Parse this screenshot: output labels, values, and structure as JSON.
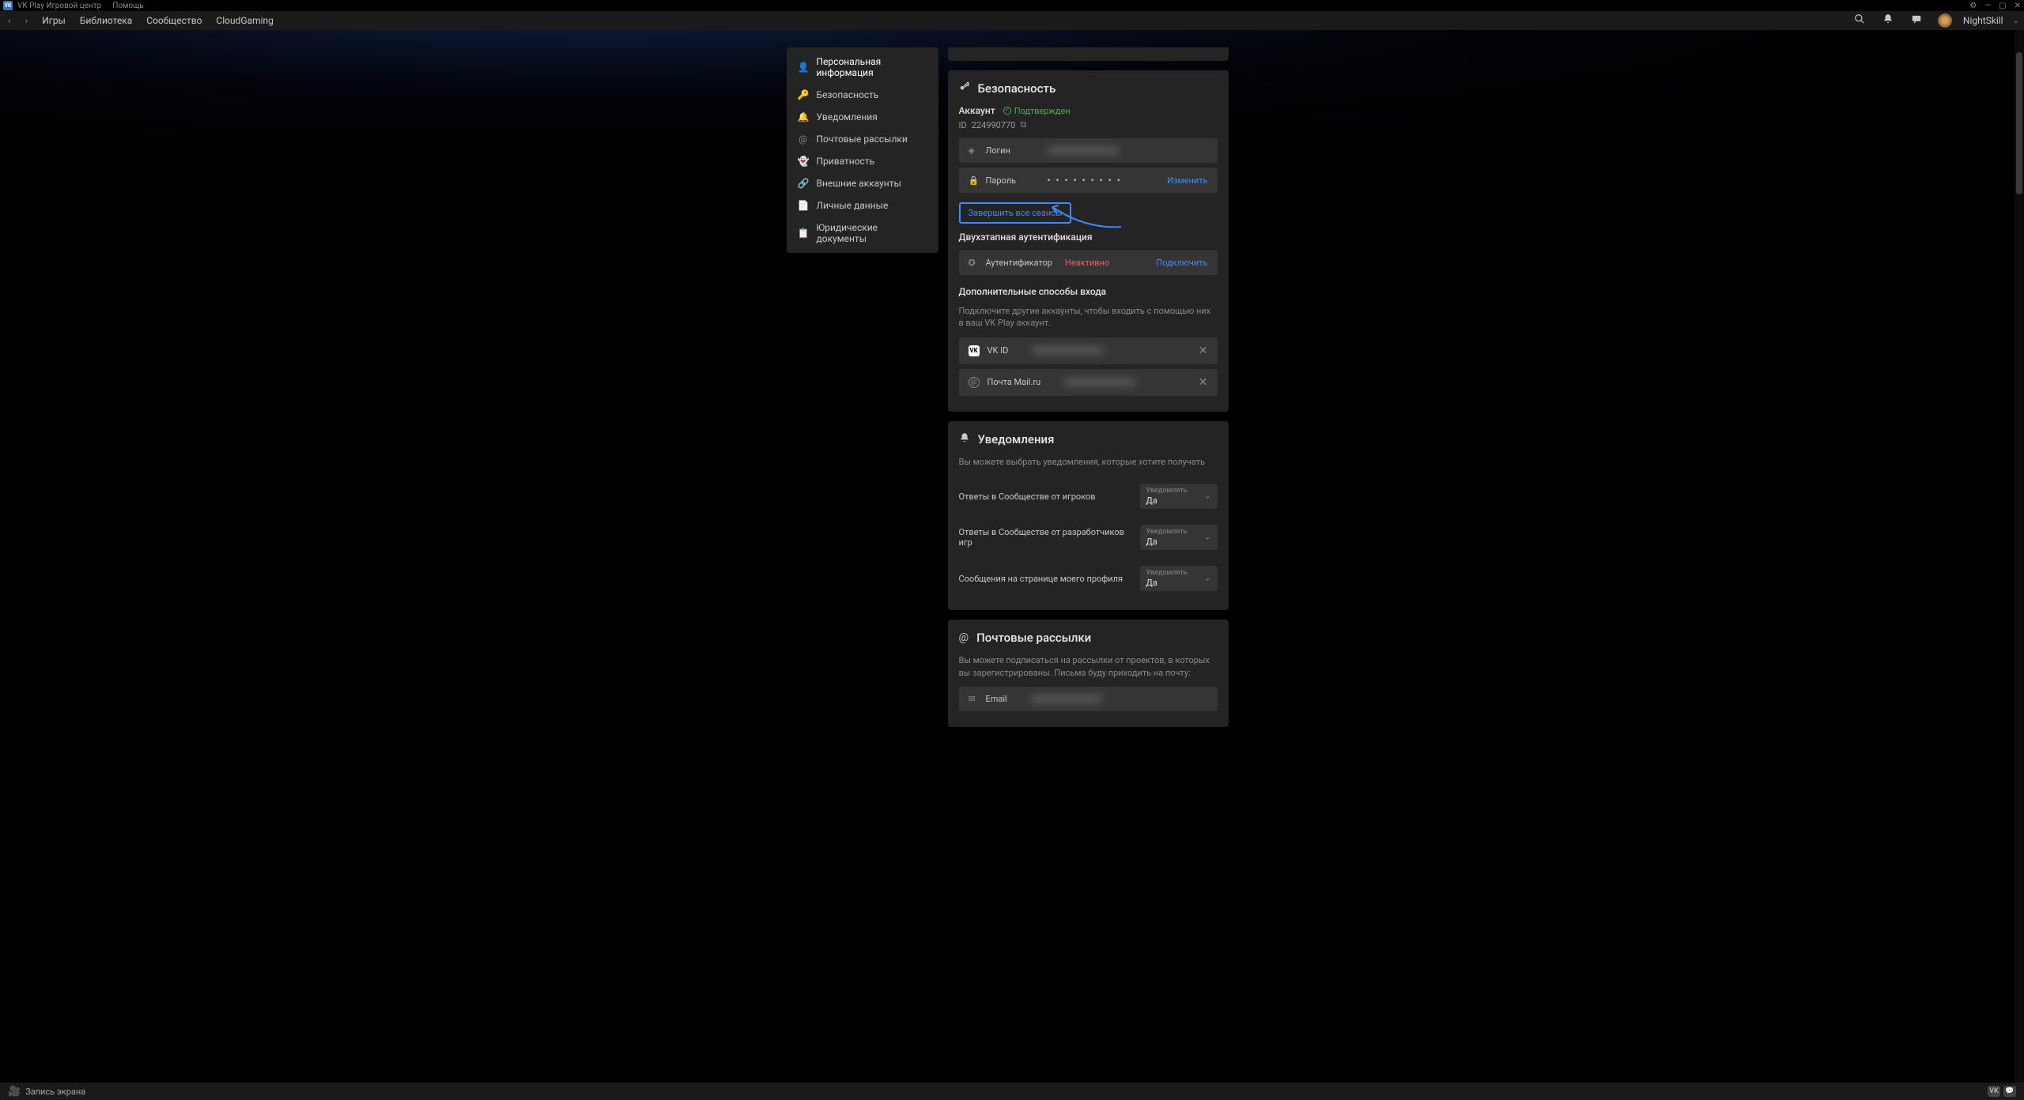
{
  "titlebar": {
    "app_title": "VK Play Игровой центр",
    "help": "Помощь"
  },
  "topnav": {
    "items": [
      "Игры",
      "Библиотека",
      "Сообщество",
      "CloudGaming"
    ],
    "username": "NightSkill"
  },
  "sidebar": {
    "items": [
      {
        "icon": "👤",
        "label": "Персональная информация"
      },
      {
        "icon": "🔑",
        "label": "Безопасность"
      },
      {
        "icon": "🔔",
        "label": "Уведомления"
      },
      {
        "icon": "@",
        "label": "Почтовые рассылки"
      },
      {
        "icon": "👻",
        "label": "Приватность"
      },
      {
        "icon": "🔗",
        "label": "Внешние аккаунты"
      },
      {
        "icon": "📄",
        "label": "Личные данные"
      },
      {
        "icon": "📋",
        "label": "Юридические документы"
      }
    ]
  },
  "security": {
    "title": "Безопасность",
    "account_label": "Аккаунт",
    "verified": "Подтвержден",
    "id_label": "ID",
    "id_value": "224990770",
    "login_label": "Логин",
    "password_label": "Пароль",
    "password_dots": "• • • • • • • • •",
    "change": "Изменить",
    "end_sessions": "Завершить все сеансы",
    "two_factor_heading": "Двухэтапная аутентификация",
    "authenticator": "Аутентификатор",
    "inactive": "Неактивно",
    "connect": "Подключить",
    "extra_heading": "Дополнительные способы входа",
    "extra_text": "Подключите другие аккаунты, чтобы входить с помощью них в ваш VK Play аккаунт.",
    "vk_id": "VK ID",
    "mail_ru": "Почта Mail.ru"
  },
  "notifications": {
    "title": "Уведомления",
    "subtitle": "Вы можете выбрать уведомления, которые хотите получать",
    "select_caption": "Уведомлять",
    "select_value": "Да",
    "rows": [
      "Ответы в Сообществе от игроков",
      "Ответы в Сообществе от разработчиков игр",
      "Сообщения на странице моего профиля"
    ]
  },
  "mailings": {
    "title": "Почтовые рассылки",
    "subtitle": "Вы можете подписаться на рассылки от проектов, в которых вы зарегистрированы. Письма буду приходить на почту:",
    "email_label": "Email"
  },
  "bottombar": {
    "recording": "Запись экрана"
  }
}
